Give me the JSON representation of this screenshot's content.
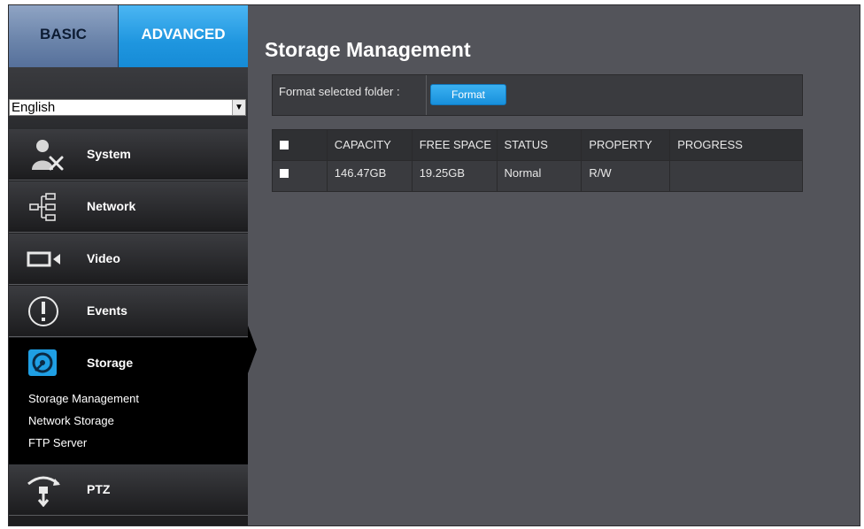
{
  "sidebar": {
    "tabs": {
      "basic": "BASIC",
      "advanced": "ADVANCED"
    },
    "language": {
      "selected": "English"
    },
    "items": [
      {
        "label": "System",
        "icon": "system-admin-icon"
      },
      {
        "label": "Network",
        "icon": "network-icon"
      },
      {
        "label": "Video",
        "icon": "video-camera-icon"
      },
      {
        "label": "Events",
        "icon": "alert-icon"
      },
      {
        "label": "Storage",
        "icon": "storage-icon"
      },
      {
        "label": "PTZ",
        "icon": "ptz-icon"
      }
    ],
    "storage_subitems": [
      "Storage Management",
      "Network Storage",
      "FTP Server"
    ]
  },
  "main": {
    "title": "Storage Management",
    "format": {
      "label": "Format selected folder :",
      "button": "Format"
    },
    "table": {
      "columns": [
        "CAPACITY",
        "FREE SPACE",
        "STATUS",
        "PROPERTY",
        "PROGRESS"
      ],
      "rows": [
        {
          "capacity": "146.47GB",
          "free_space": "19.25GB",
          "status": "Normal",
          "property": "R/W",
          "progress": ""
        }
      ]
    }
  },
  "colors": {
    "accent": "#1f96df",
    "panel": "#53545a",
    "sidebar": "#1e1e20"
  }
}
